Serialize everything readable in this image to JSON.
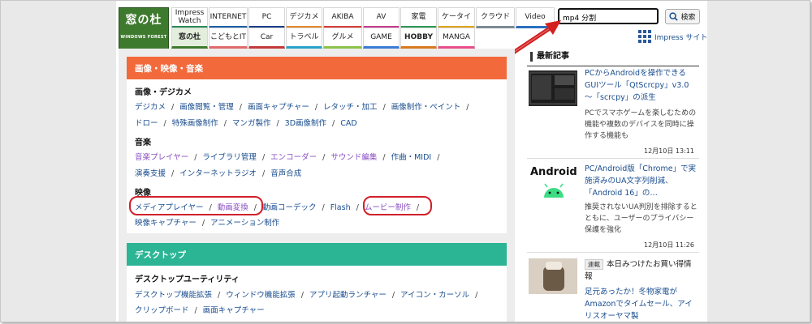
{
  "logo": {
    "title": "窓の杜",
    "subtitle": "WINDOWS FOREST"
  },
  "nav": {
    "row1": [
      "Impress\nWatch",
      "INTERNET",
      "PC",
      "デジカメ",
      "AKIBA",
      "AV",
      "家電",
      "ケータイ",
      "クラウド",
      "Video"
    ],
    "row2": [
      "窓の杜",
      "こどもとIT",
      "Car",
      "トラベル",
      "グルメ",
      "GAME",
      "HOBBY",
      "MANGA"
    ]
  },
  "search": {
    "value": "mp4 分割",
    "button_label": "検索"
  },
  "impress_site": "Impress サイト",
  "sections": {
    "media": {
      "title": "画像・映像・音楽",
      "color": "#f26a3b",
      "cat1": {
        "title": "画像・デジカメ",
        "links": [
          "デジカメ",
          "画像閲覧・管理",
          "画面キャプチャー",
          "レタッチ・加工",
          "画像制作・ペイント",
          "ドロー",
          "特殊画像制作",
          "マンガ製作",
          "3D画像制作",
          "CAD"
        ]
      },
      "cat2": {
        "title": "音楽",
        "links": [
          "音楽プレイヤー",
          "ライブラリ管理",
          "エンコーダー",
          "サウンド編集",
          "作曲・MIDI",
          "演奏支援",
          "インターネットラジオ",
          "音声合成"
        ]
      },
      "cat3": {
        "title": "映像",
        "links": [
          "メディアプレイヤー",
          "動画変換",
          "動画コーデック",
          "Flash",
          "ムービー制作",
          "映像キャプチャー",
          "アニメーション制作"
        ]
      }
    },
    "desktop": {
      "title": "デスクトップ",
      "color": "#2bb595",
      "cat1": {
        "title": "デスクトップユーティリティ",
        "links": [
          "デスクトップ機能拡張",
          "ウィンドウ機能拡張",
          "アプリ起動ランチャー",
          "アイコン・カーソル",
          "クリップボード",
          "画面キャプチャー"
        ]
      }
    }
  },
  "latest": {
    "heading": "最新記事",
    "articles": [
      {
        "title": "PCからAndroidを操作できるGUIツール「QtScrcpy」v3.0 ～「scrcpy」の派生",
        "desc": "PCでスマホゲームを楽しむための機能や複数のデバイスを同時に操作する機能も",
        "date": "12月10日 13:11"
      },
      {
        "title": "PC/Android版「Chrome」で実施済みのUA文字列削減、「Android 16」の…",
        "desc": "推奨されないUA判別を排除するとともに、ユーザーのプライバシー保護を強化",
        "date": "12月10日 11:26",
        "thumb_text": "Android"
      },
      {
        "badge": "連載",
        "title": "本日みつけたお買い得情報",
        "desc": "足元あったか！冬物家電がAmazonでタイムセール、アイリスオーヤマ製"
      }
    ]
  },
  "colors": {
    "accent_orange": "#f26a3b",
    "accent_green": "#2bb595",
    "link": "#1a4d8f",
    "visited": "#8a4fc2",
    "highlight_red": "#d0202a"
  }
}
